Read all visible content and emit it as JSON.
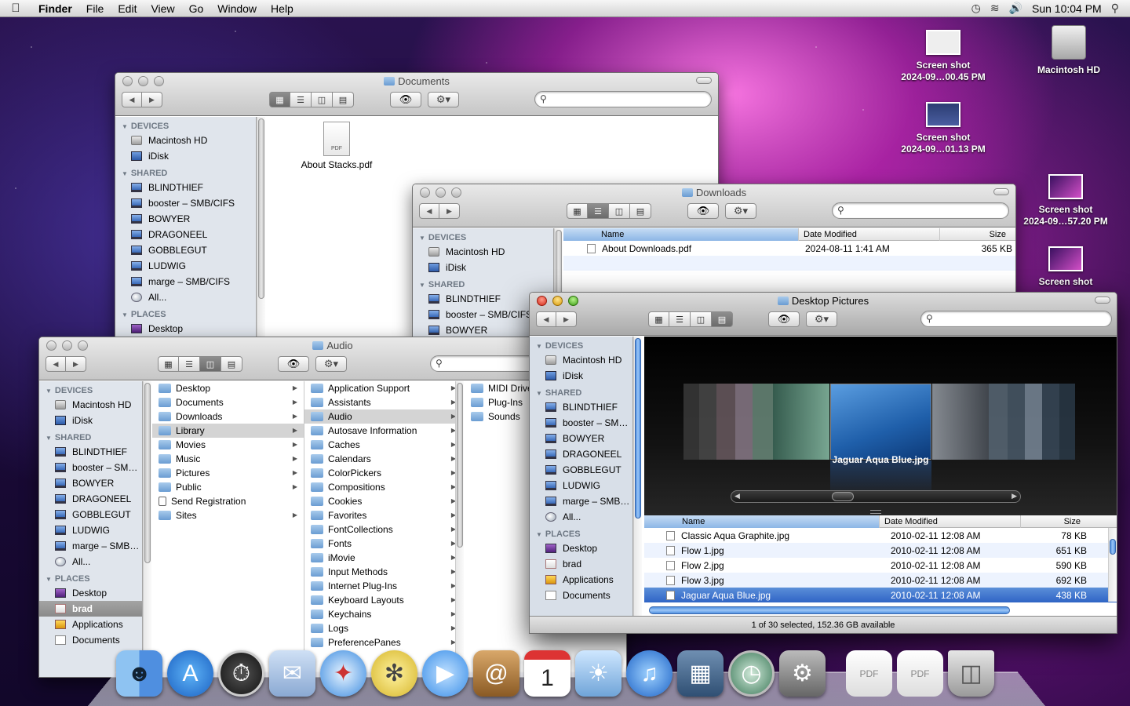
{
  "menubar": {
    "app": "Finder",
    "items": [
      "File",
      "Edit",
      "View",
      "Go",
      "Window",
      "Help"
    ],
    "clock": "Sun 10:04 PM"
  },
  "desktop_icons": [
    {
      "line1": "Screen shot",
      "line2": "2024-09…00.45 PM"
    },
    {
      "line1": "Screen shot",
      "line2": "2024-09…01.13 PM"
    },
    {
      "line1": "Screen shot",
      "line2": "2024-09…57.20 PM"
    },
    {
      "line1": "Screen shot",
      "line2": ""
    }
  ],
  "hd_label": "Macintosh HD",
  "sidebar": {
    "devices_label": "DEVICES",
    "shared_label": "SHARED",
    "places_label": "PLACES",
    "devices": [
      "Macintosh HD",
      "iDisk"
    ],
    "shared_full": [
      "BLINDTHIEF",
      "booster – SMB/CIFS",
      "BOWYER",
      "DRAGONEEL",
      "GOBBLEGUT",
      "LUDWIG",
      "marge – SMB/CIFS",
      "All..."
    ],
    "shared_short": [
      "BLINDTHIEF",
      "booster – SM…",
      "BOWYER",
      "DRAGONEEL",
      "GOBBLEGUT",
      "LUDWIG",
      "marge – SMB…",
      "All..."
    ],
    "places": [
      "Desktop",
      "brad",
      "Applications",
      "Documents"
    ]
  },
  "documents_window": {
    "title": "Documents",
    "file": "About Stacks.pdf"
  },
  "downloads_window": {
    "title": "Downloads",
    "columns": [
      "Name",
      "Date Modified",
      "Size"
    ],
    "rows": [
      {
        "name": "About Downloads.pdf",
        "date": "2024-08-11 1:41 AM",
        "size": "365 KB"
      }
    ]
  },
  "audio_window": {
    "title": "Audio",
    "col1": [
      "Desktop",
      "Documents",
      "Downloads",
      "Library",
      "Movies",
      "Music",
      "Pictures",
      "Public",
      "Send Registration",
      "Sites"
    ],
    "col2": [
      "Application Support",
      "Assistants",
      "Audio",
      "Autosave Information",
      "Caches",
      "Calendars",
      "ColorPickers",
      "Compositions",
      "Cookies",
      "Favorites",
      "FontCollections",
      "Fonts",
      "iMovie",
      "Input Methods",
      "Internet Plug-Ins",
      "Keyboard Layouts",
      "Keychains",
      "Logs",
      "PreferencePanes"
    ],
    "col3": [
      "MIDI Drivers",
      "Plug-Ins",
      "Sounds"
    ]
  },
  "pictures_window": {
    "title": "Desktop Pictures",
    "cover_label": "Jaguar Aqua Blue.jpg",
    "columns": [
      "Name",
      "Date Modified",
      "Size"
    ],
    "rows": [
      {
        "name": "Classic Aqua Graphite.jpg",
        "date": "2010-02-11 12:08 AM",
        "size": "78 KB"
      },
      {
        "name": "Flow 1.jpg",
        "date": "2010-02-11 12:08 AM",
        "size": "651 KB"
      },
      {
        "name": "Flow 2.jpg",
        "date": "2010-02-11 12:08 AM",
        "size": "590 KB"
      },
      {
        "name": "Flow 3.jpg",
        "date": "2010-02-11 12:08 AM",
        "size": "692 KB"
      },
      {
        "name": "Jaguar Aqua Blue.jpg",
        "date": "2010-02-11 12:08 AM",
        "size": "438 KB"
      }
    ],
    "status": "1 of 30 selected, 152.36 GB available"
  },
  "dock": [
    "Finder",
    "App Store",
    "Dashboard",
    "Mail",
    "Safari",
    "Spider",
    "iChat",
    "Address Book",
    "iCal",
    "iPhoto",
    "iTunes",
    "Spaces",
    "Time Machine",
    "System Preferences",
    "Documents",
    "Downloads",
    "Trash"
  ]
}
